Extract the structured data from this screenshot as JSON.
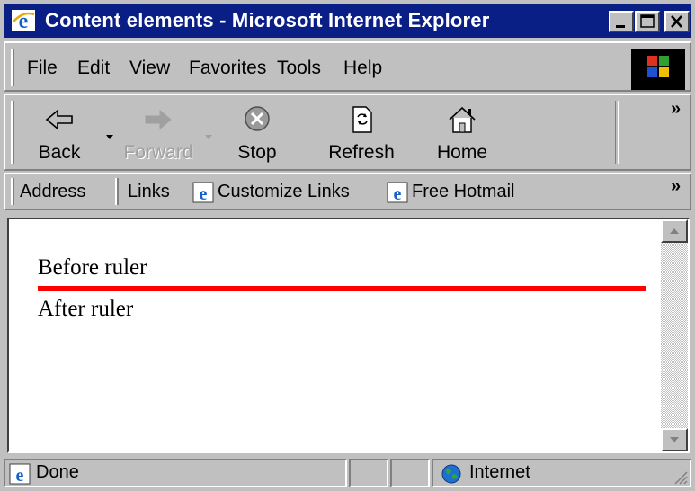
{
  "window": {
    "title": "Content elements - Microsoft Internet Explorer"
  },
  "menu": {
    "items": [
      "File",
      "Edit",
      "View",
      "Favorites",
      "Tools",
      "Help"
    ]
  },
  "toolbar": {
    "back_label": "Back",
    "forward_label": "Forward",
    "stop_label": "Stop",
    "refresh_label": "Refresh",
    "home_label": "Home",
    "more": "»"
  },
  "linkbar": {
    "address_label": "Address",
    "links_label": "Links",
    "customize_links": "Customize Links",
    "free_hotmail": "Free Hotmail",
    "more": "»"
  },
  "document": {
    "before_text": "Before ruler",
    "after_text": "After ruler",
    "ruler_color": "#ff0000"
  },
  "status": {
    "text": "Done",
    "zone": "Internet"
  }
}
